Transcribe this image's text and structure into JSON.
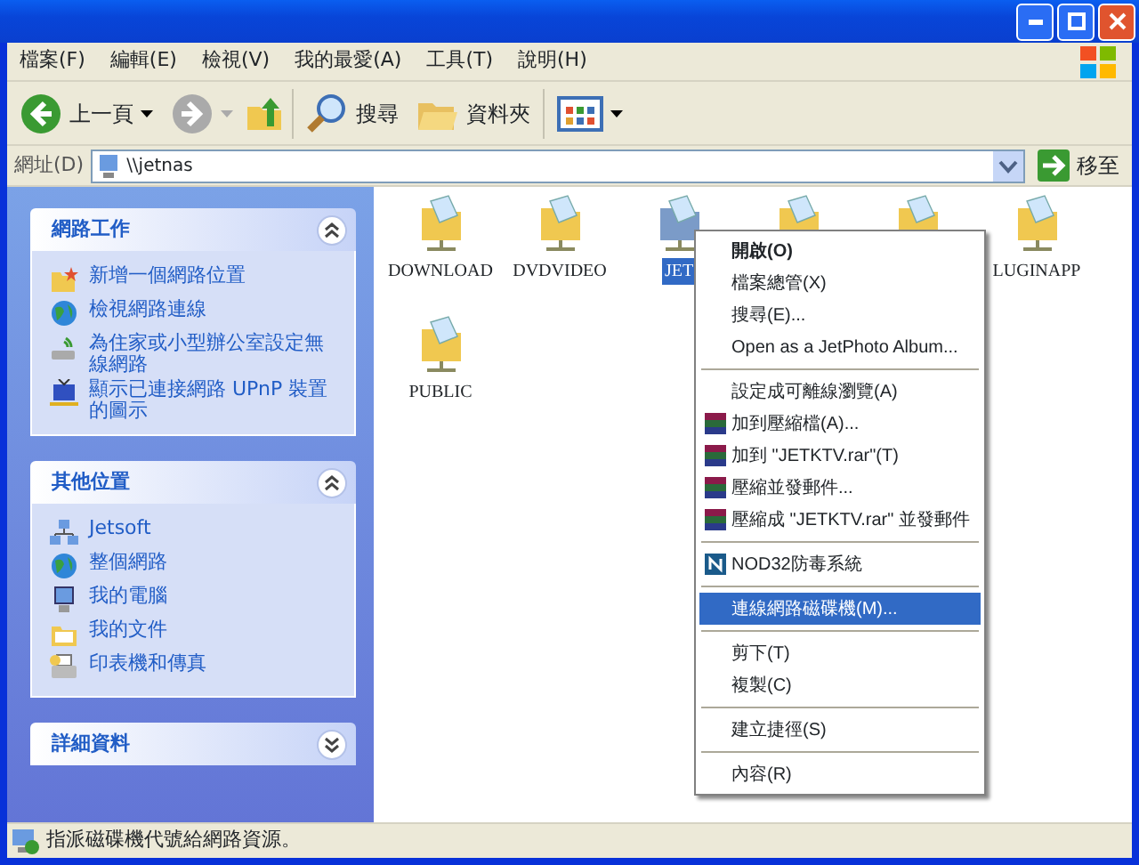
{
  "menu_bar": [
    "檔案(F)",
    "編輯(E)",
    "檢視(V)",
    "我的最愛(A)",
    "工具(T)",
    "說明(H)"
  ],
  "toolbar": {
    "back": "上一頁",
    "search": "搜尋",
    "folders": "資料夾"
  },
  "address": {
    "label": "網址(D)",
    "value": "\\\\jetnas",
    "go": "移至"
  },
  "task_panels": [
    {
      "title": "網路工作",
      "expanded": true,
      "items": [
        {
          "label": "新增一個網路位置",
          "kind": "add"
        },
        {
          "label": "檢視網路連線",
          "kind": "globe"
        },
        {
          "label": "為住家或小型辦公室設定無線網路",
          "kind": "wireless"
        },
        {
          "label": "顯示已連接網路 UPnP 裝置的圖示",
          "kind": "upnp"
        }
      ]
    },
    {
      "title": "其他位置",
      "expanded": true,
      "items": [
        {
          "label": "Jetsoft",
          "kind": "network"
        },
        {
          "label": "整個網路",
          "kind": "globe"
        },
        {
          "label": "我的電腦",
          "kind": "computer"
        },
        {
          "label": "我的文件",
          "kind": "docs"
        },
        {
          "label": "印表機和傳真",
          "kind": "printer"
        }
      ]
    },
    {
      "title": "詳細資料",
      "expanded": false
    }
  ],
  "shares": [
    {
      "label": "DOWNLOAD",
      "selected": false
    },
    {
      "label": "DVDVIDEO",
      "selected": false
    },
    {
      "label": "JET",
      "selected": true
    },
    {
      "selected": false
    },
    {
      "selected": false
    },
    {
      "label": "LUGINAPP",
      "selected": false
    },
    {
      "label": "PUBLIC",
      "selected": false
    }
  ],
  "context_menu": [
    {
      "kind": "item",
      "label": "開啟(O)",
      "bold": true,
      "selected": false
    },
    {
      "kind": "item",
      "label": "檔案總管(X)",
      "selected": false
    },
    {
      "kind": "item",
      "label": "搜尋(E)...",
      "selected": false
    },
    {
      "kind": "item",
      "label": "Open as a JetPhoto Album...",
      "selected": false
    },
    {
      "kind": "separator"
    },
    {
      "kind": "item",
      "label": "設定成可離線瀏覽(A)",
      "selected": false
    },
    {
      "kind": "rar",
      "label": "加到壓縮檔(A)...",
      "selected": false
    },
    {
      "kind": "rar",
      "label": "加到 \"JETKTV.rar\"(T)",
      "selected": false
    },
    {
      "kind": "rar",
      "label": "壓縮並發郵件...",
      "selected": false
    },
    {
      "kind": "rar",
      "label": "壓縮成 \"JETKTV.rar\" 並發郵件",
      "selected": false
    },
    {
      "kind": "separator"
    },
    {
      "kind": "nod",
      "label": "NOD32防毒系統",
      "selected": false
    },
    {
      "kind": "separator"
    },
    {
      "kind": "item",
      "label": "連線網路磁碟機(M)...",
      "selected": true
    },
    {
      "kind": "separator"
    },
    {
      "kind": "item",
      "label": "剪下(T)",
      "selected": false
    },
    {
      "kind": "item",
      "label": "複製(C)",
      "selected": false
    },
    {
      "kind": "separator"
    },
    {
      "kind": "item",
      "label": "建立捷徑(S)",
      "selected": false
    },
    {
      "kind": "separator"
    },
    {
      "kind": "item",
      "label": "內容(R)",
      "selected": false
    }
  ],
  "status_bar": "指派磁碟機代號給網路資源。"
}
